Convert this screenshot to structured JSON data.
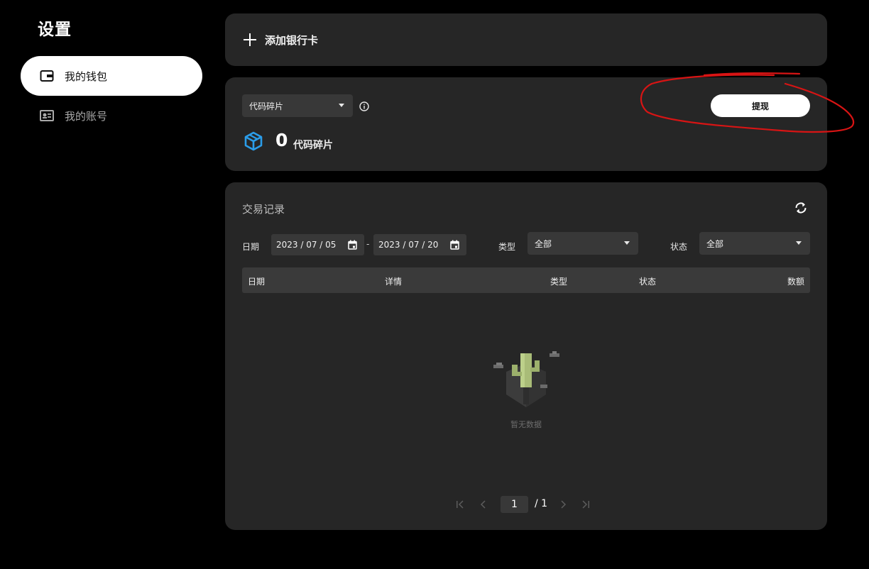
{
  "sidebar": {
    "title": "设置",
    "items": [
      {
        "label": "我的钱包",
        "icon": "wallet-icon",
        "active": true
      },
      {
        "label": "我的账号",
        "icon": "id-card-icon",
        "active": false
      }
    ]
  },
  "add_card": {
    "label": "添加银行卡",
    "icon": "plus-icon"
  },
  "wallet": {
    "currency_selected": "代码碎片",
    "balance": "0",
    "balance_unit": "代码碎片",
    "withdraw_label": "提现"
  },
  "transactions": {
    "title": "交易记录",
    "filters": {
      "date_label": "日期",
      "date_from": "2023 / 07 / 05",
      "date_to": "2023 / 07 / 20",
      "date_sep": "-",
      "type_label": "类型",
      "type_value": "全部",
      "status_label": "状态",
      "status_value": "全部"
    },
    "columns": [
      "日期",
      "详情",
      "类型",
      "状态",
      "数额"
    ],
    "empty_text": "暂无数据"
  },
  "pagination": {
    "current": "1",
    "total": "/ 1"
  },
  "colors": {
    "annotation": "#d81414",
    "card_bg": "#262626",
    "input_bg": "#383838"
  }
}
